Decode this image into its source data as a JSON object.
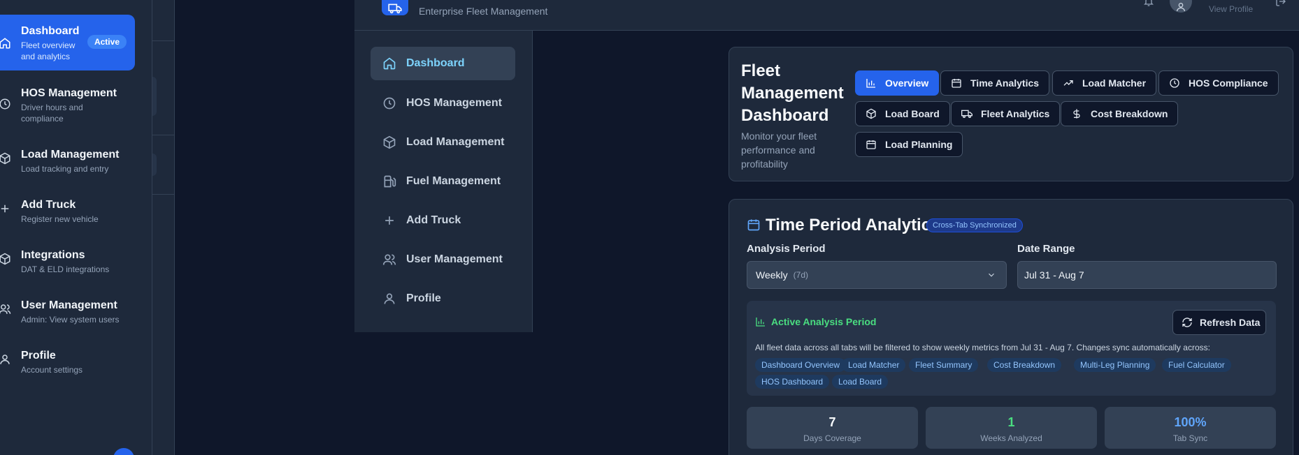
{
  "sidebar": {
    "items": [
      {
        "title": "Dashboard",
        "sub": "Fleet overview and analytics",
        "icon": "home-icon"
      },
      {
        "title": "HOS Management",
        "sub": "Driver hours and compliance",
        "icon": "clock-icon"
      },
      {
        "title": "Load Management",
        "sub": "Load tracking and entry",
        "icon": "package-icon"
      },
      {
        "title": "Add Truck",
        "sub": "Register new vehicle",
        "icon": "plus-icon"
      },
      {
        "title": "Integrations",
        "sub": "DAT & ELD integrations",
        "icon": "package-icon"
      },
      {
        "title": "User Management",
        "sub": "Admin: View system users",
        "icon": "users-icon"
      },
      {
        "title": "Profile",
        "sub": "Account settings",
        "icon": "user-icon"
      }
    ],
    "active_badge": "Active"
  },
  "header": {
    "subtitle": "Enterprise Fleet Management",
    "view_profile": "View Profile"
  },
  "nav": {
    "items": [
      {
        "label": "Dashboard",
        "icon": "home-icon"
      },
      {
        "label": "HOS Management",
        "icon": "clock-icon"
      },
      {
        "label": "Load Management",
        "icon": "package-icon"
      },
      {
        "label": "Fuel Management",
        "icon": "fuel-icon"
      },
      {
        "label": "Add Truck",
        "icon": "plus-icon"
      },
      {
        "label": "User Management",
        "icon": "users-icon"
      },
      {
        "label": "Profile",
        "icon": "user-icon"
      }
    ]
  },
  "dashboard": {
    "title": "Fleet Management Dashboard",
    "description": "Monitor your fleet performance and profitability",
    "tabs": [
      {
        "label": "Overview",
        "icon": "bar-chart-icon"
      },
      {
        "label": "Time Analytics",
        "icon": "calendar-icon"
      },
      {
        "label": "Load Matcher",
        "icon": "trending-up-icon"
      },
      {
        "label": "HOS Compliance",
        "icon": "clock-icon"
      },
      {
        "label": "Load Board",
        "icon": "package-icon"
      },
      {
        "label": "Fleet Analytics",
        "icon": "truck-icon"
      },
      {
        "label": "Cost Breakdown",
        "icon": "dollar-icon"
      },
      {
        "label": "Load Planning",
        "icon": "calendar-icon"
      }
    ]
  },
  "analytics": {
    "title": "Time Period Analytics",
    "sync_badge": "Cross-Tab Synchronized",
    "period_label": "Analysis Period",
    "period_value": "Weekly",
    "period_hint": "(7d)",
    "range_label": "Date Range",
    "range_value": "Jul 31 - Aug 7",
    "active_title": "Active Analysis Period",
    "refresh_label": "Refresh Data",
    "active_text": "All fleet data across all tabs will be filtered to show weekly metrics from Jul 31 - Aug 7. Changes sync automatically across:",
    "chips": [
      "Dashboard Overview",
      "Load Matcher",
      "Fleet Summary",
      "Cost Breakdown",
      "Multi-Leg Planning",
      "Fuel Calculator",
      "HOS Dashboard",
      "Load Board"
    ],
    "stats": [
      {
        "value": "7",
        "label": "Days Coverage",
        "color": "#f8fafc"
      },
      {
        "value": "1",
        "label": "Weeks Analyzed",
        "color": "#4ade80"
      },
      {
        "value": "100%",
        "label": "Tab Sync",
        "color": "#60a5fa"
      }
    ]
  }
}
